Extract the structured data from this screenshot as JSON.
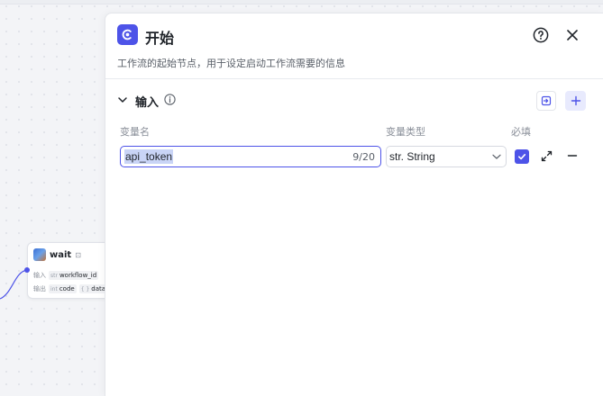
{
  "canvas": {
    "node": {
      "title": "wait",
      "flag": "⊡",
      "input_label": "输入",
      "input_type": "str",
      "input_param": "workflow_id",
      "output_label": "输出",
      "output_params": [
        {
          "type": "int",
          "name": "code"
        },
        {
          "type": "{ }",
          "name": "data"
        }
      ]
    }
  },
  "panel": {
    "title": "开始",
    "description": "工作流的起始节点，用于设定启动工作流需要的信息",
    "section": {
      "title": "输入",
      "columns": {
        "name": "变量名",
        "type": "变量类型",
        "required": "必填"
      },
      "rows": [
        {
          "name": "api_token",
          "char_count": "9/20",
          "type": "str. String",
          "required": true
        }
      ]
    }
  },
  "colors": {
    "accent": "#4d53e8",
    "accent_soft": "#e8eafd",
    "selection": "#c9d4f6"
  },
  "icons": {
    "panel": "start-node-icon",
    "help": "help-circle-icon",
    "close": "close-icon",
    "toggle": "chevron-down-icon",
    "info": "info-icon",
    "import": "import-icon",
    "add": "plus-icon",
    "expand": "expand-icon",
    "remove": "minus-icon",
    "check": "check-icon"
  }
}
